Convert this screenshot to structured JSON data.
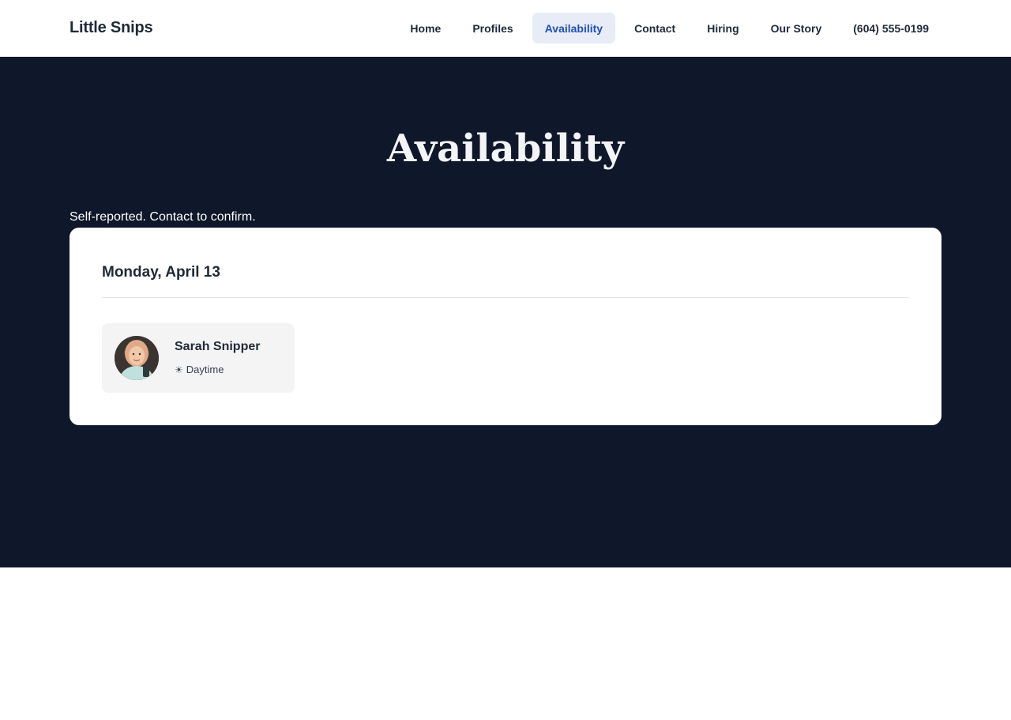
{
  "header": {
    "brand": "Little Snips",
    "nav": [
      {
        "label": "Home",
        "active": false
      },
      {
        "label": "Profiles",
        "active": false
      },
      {
        "label": "Availability",
        "active": true
      },
      {
        "label": "Contact",
        "active": false
      },
      {
        "label": "Hiring",
        "active": false
      },
      {
        "label": "Our Story",
        "active": false
      },
      {
        "label": "(604) 555-0199",
        "active": false
      }
    ]
  },
  "hero": {
    "title": "Availability",
    "note": "Self-reported. Contact to confirm."
  },
  "schedule": {
    "day": "Monday, April 13",
    "people": [
      {
        "name": "Sarah Snipper",
        "shift": "Daytime",
        "shift_icon": "sun-icon",
        "avatar_icon": "avatar-photo"
      }
    ]
  },
  "colors": {
    "hero_bg": "#0f172a",
    "active_nav_bg": "#e8ecf7",
    "active_nav_text": "#1e4fb8"
  }
}
